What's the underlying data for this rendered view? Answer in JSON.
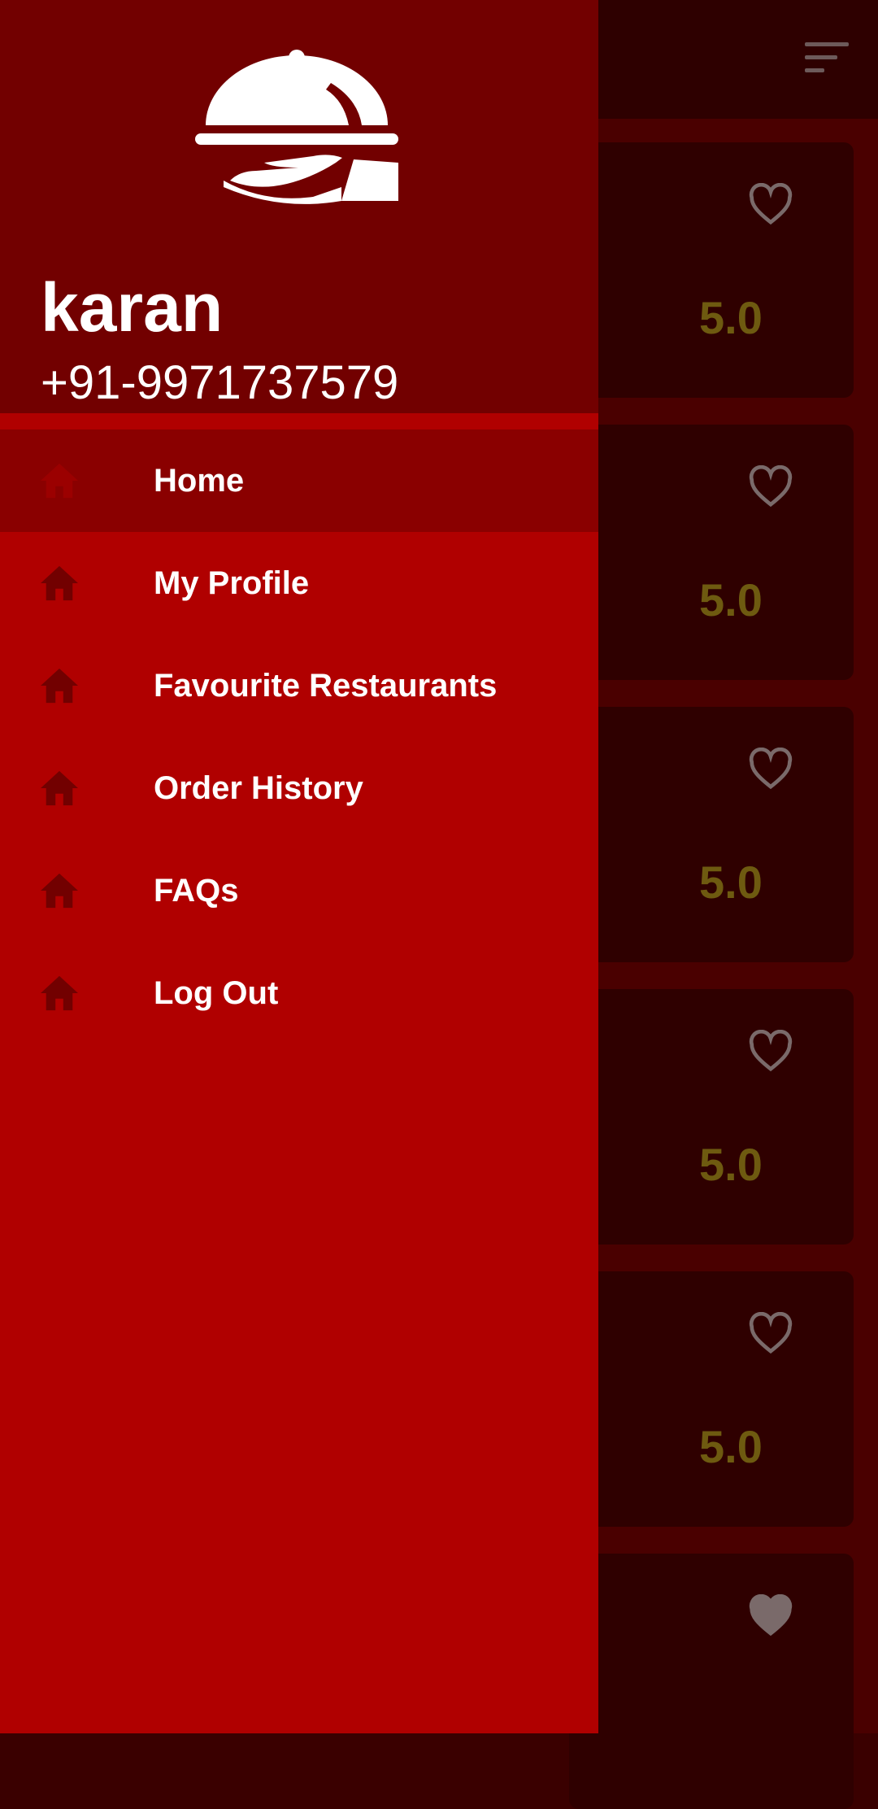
{
  "background": {
    "appbar": {
      "sort_icon": "sort-lines-icon"
    },
    "restaurant_cards": [
      {
        "rating": "5.0",
        "favourite": false
      },
      {
        "rating": "5.0",
        "favourite": false
      },
      {
        "rating": "5.0",
        "favourite": false
      },
      {
        "rating": "5.0",
        "favourite": false
      },
      {
        "rating": "5.0",
        "favourite": false
      },
      {
        "rating": "",
        "favourite": true
      }
    ]
  },
  "drawer": {
    "header": {
      "logo_icon": "serving-cloche-hand-icon",
      "user_name": "karan",
      "user_phone": "+91-9971737579"
    },
    "items": [
      {
        "label": "Home",
        "icon": "home-icon",
        "active": true
      },
      {
        "label": "My Profile",
        "icon": "home-icon",
        "active": false
      },
      {
        "label": "Favourite Restaurants",
        "icon": "home-icon",
        "active": false
      },
      {
        "label": "Order History",
        "icon": "home-icon",
        "active": false
      },
      {
        "label": "FAQs",
        "icon": "home-icon",
        "active": false
      },
      {
        "label": "Log Out",
        "icon": "home-icon",
        "active": false
      }
    ]
  },
  "colors": {
    "drawer_bg": "#b00000",
    "drawer_header_bg": "#720000",
    "active_item_bg": "#8a0000",
    "icon_color": "#720000",
    "rating_color": "#6e5a10"
  }
}
